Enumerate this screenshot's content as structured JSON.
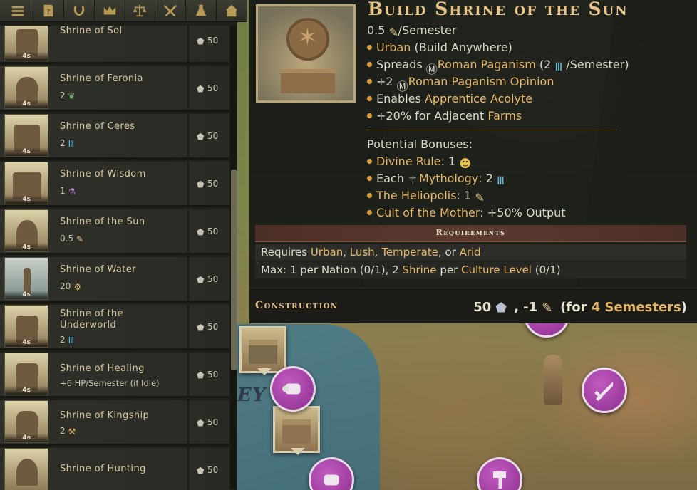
{
  "topbar": {
    "buttons": [
      "menu-icon",
      "civilopedia-icon",
      "laurel-icon",
      "crown-icon",
      "scales-icon",
      "crossed-swords-icon",
      "flask-icon",
      "home-icon"
    ]
  },
  "list": {
    "items": [
      {
        "name": "Shrine of Sol",
        "turns": "4s",
        "sub": "",
        "sub_icon": "",
        "cost": "50"
      },
      {
        "name": "Shrine of Feronia",
        "turns": "4s",
        "sub": "2",
        "sub_icon": "leaf-icon",
        "cost": "50"
      },
      {
        "name": "Shrine of Ceres",
        "turns": "4s",
        "sub": "2",
        "sub_icon": "religion-icon",
        "cost": "50"
      },
      {
        "name": "Shrine of Wisdom",
        "turns": "4s",
        "sub": "1",
        "sub_icon": "flask-icon",
        "cost": "50"
      },
      {
        "name": "Shrine of the Sun",
        "turns": "4s",
        "sub": "0.5",
        "sub_icon": "scroll-icon",
        "cost": "50"
      },
      {
        "name": "Shrine of Water",
        "turns": "4s",
        "sub": "20",
        "sub_icon": "gear-icon",
        "cost": "50"
      },
      {
        "name": "Shrine of the Underworld",
        "turns": "4s",
        "sub": "2",
        "sub_icon": "religion-icon",
        "cost": "50"
      },
      {
        "name": "Shrine of Healing",
        "turns": "4s",
        "sub": "+6 HP/Semester (if Idle)",
        "sub_icon": "",
        "cost": "50"
      },
      {
        "name": "Shrine of Kingship",
        "turns": "4s",
        "sub": "2",
        "sub_icon": "hammer-icon",
        "cost": "50"
      },
      {
        "name": "Shrine of Hunting",
        "turns": "",
        "sub": "",
        "sub_icon": "",
        "cost": "50"
      }
    ]
  },
  "tooltip": {
    "title": "Build Shrine of the Sun",
    "rate": {
      "value": "0.5",
      "unit": "/Semester"
    },
    "bullets": {
      "urban": "Urban",
      "urban_suffix": " (Build Anywhere)",
      "spreads_prefix": "Spreads ",
      "religion": "Roman Paganism",
      "spreads_suffix_pre": " (2 ",
      "spreads_suffix_post": "/Semester)",
      "opinion_prefix": "+2 ",
      "opinion_label": "Roman Paganism Opinion",
      "enables_prefix": "Enables ",
      "enables_unit": "Apprentice Acolyte",
      "adjacent_prefix": "+20% for Adjacent ",
      "adjacent_target": "Farms"
    },
    "potential_bonuses_label": "Potential Bonuses:",
    "bonuses": {
      "divine_rule": "Divine Rule",
      "divine_rule_val": ": 1 ",
      "each": "Each ",
      "mythology": "Mythology",
      "mythology_val": ": 2 ",
      "heliopolis": "The Heliopolis",
      "heliopolis_val": ": 1 ",
      "mother": "Cult of the Mother",
      "mother_val": ": +50% Output"
    },
    "requirements_header": "Requirements",
    "req1": {
      "prefix": "Requires ",
      "a": "Urban",
      "b": "Lush",
      "c": "Temperate",
      "or": ", or ",
      "d": "Arid"
    },
    "req2": {
      "prefix": "Max: 1 per Nation (0/1), 2 ",
      "shrine": "Shrine",
      "mid": " per ",
      "level": "Culture Level",
      "suffix": " (0/1)"
    },
    "construction_label": "Construction",
    "construction": {
      "stone": "50",
      "scroll": "-1",
      "for_prefix": "(for ",
      "semesters": "4 Semesters",
      "for_suffix": ")"
    }
  },
  "map": {
    "region_text": "EY"
  },
  "colors": {
    "accent": "#e8b766",
    "title": "#e8c488",
    "unit_badge": "#a43ea6"
  }
}
